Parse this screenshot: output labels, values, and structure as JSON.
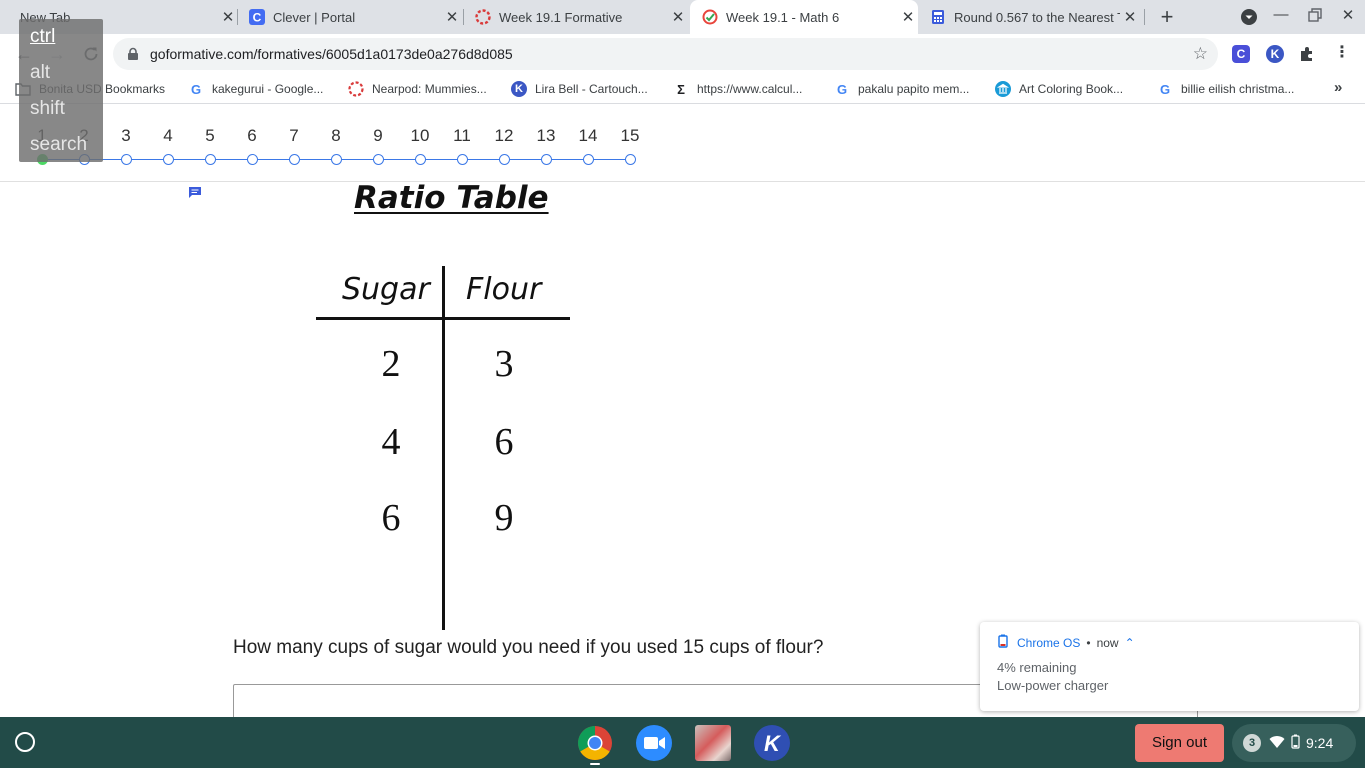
{
  "tabs": [
    {
      "title": "New Tab",
      "favicon": "none",
      "active": false
    },
    {
      "title": "Clever | Portal",
      "favicon": "clever-icon",
      "active": false
    },
    {
      "title": "Week 19.1 Formative",
      "favicon": "formative-icon",
      "active": false
    },
    {
      "title": "Week 19.1 - Math 6",
      "favicon": "formative-check-icon",
      "active": true
    },
    {
      "title": "Round 0.567 to the Nearest T",
      "favicon": "calculator-icon",
      "active": false
    }
  ],
  "omnibox": {
    "url": "goformative.com/formatives/6005d1a0173de0a276d8d085"
  },
  "bookmarks": [
    {
      "label": "Bonita USD Bookmarks",
      "icon": "folder-icon"
    },
    {
      "label": "kakegurui - Google...",
      "icon": "google-icon"
    },
    {
      "label": "Nearpod: Mummies...",
      "icon": "nearpod-icon"
    },
    {
      "label": "Lira Bell - Cartouch...",
      "icon": "k-icon"
    },
    {
      "label": "https://www.calcul...",
      "icon": "sigma-icon"
    },
    {
      "label": "pakalu papito mem...",
      "icon": "google-icon"
    },
    {
      "label": "Art Coloring Book...",
      "icon": "museum-icon"
    },
    {
      "label": "billie eilish christma...",
      "icon": "google-icon"
    }
  ],
  "bookmarks_overflow": "»",
  "keyboard_overlay": {
    "keys": [
      "ctrl",
      "alt",
      "shift",
      "search"
    ]
  },
  "stepper": {
    "steps": [
      "1",
      "2",
      "3",
      "4",
      "5",
      "6",
      "7",
      "8",
      "9",
      "10",
      "11",
      "12",
      "13",
      "14",
      "15"
    ],
    "current": 1
  },
  "question_image": {
    "title": "Ratio Table",
    "headers": [
      "Sugar",
      "Flour"
    ],
    "rows": [
      [
        "2",
        "3"
      ],
      [
        "4",
        "6"
      ],
      [
        "6",
        "9"
      ]
    ]
  },
  "question": {
    "text": "How many cups of sugar would you need if you used 15 cups of flour?",
    "answer_value": ""
  },
  "notification": {
    "source": "Chrome OS",
    "separator": "•",
    "time": "now",
    "line1": "4% remaining",
    "line2": "Low-power charger"
  },
  "shelf": {
    "apps": [
      "chrome-icon",
      "zoom-icon",
      "photo-app-icon",
      "k-app-icon"
    ],
    "signout_label": "Sign out",
    "notification_count": "3",
    "time": "9:24"
  }
}
